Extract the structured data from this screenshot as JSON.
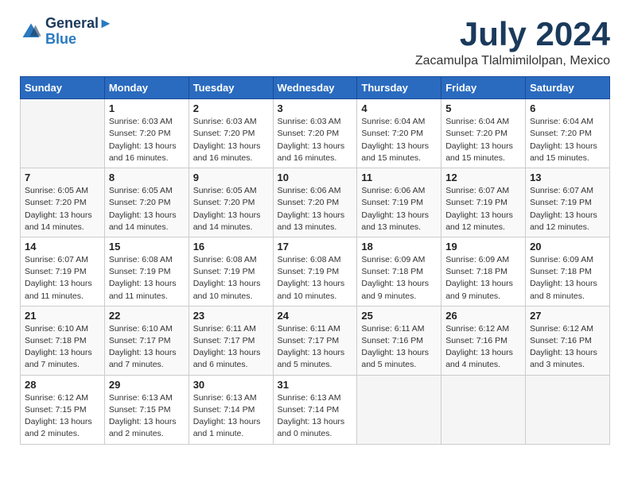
{
  "header": {
    "logo_line1": "General",
    "logo_line2": "Blue",
    "month_title": "July 2024",
    "location": "Zacamulpa Tlalmimilolpan, Mexico"
  },
  "weekdays": [
    "Sunday",
    "Monday",
    "Tuesday",
    "Wednesday",
    "Thursday",
    "Friday",
    "Saturday"
  ],
  "weeks": [
    [
      {
        "day": "",
        "info": ""
      },
      {
        "day": "1",
        "info": "Sunrise: 6:03 AM\nSunset: 7:20 PM\nDaylight: 13 hours\nand 16 minutes."
      },
      {
        "day": "2",
        "info": "Sunrise: 6:03 AM\nSunset: 7:20 PM\nDaylight: 13 hours\nand 16 minutes."
      },
      {
        "day": "3",
        "info": "Sunrise: 6:03 AM\nSunset: 7:20 PM\nDaylight: 13 hours\nand 16 minutes."
      },
      {
        "day": "4",
        "info": "Sunrise: 6:04 AM\nSunset: 7:20 PM\nDaylight: 13 hours\nand 15 minutes."
      },
      {
        "day": "5",
        "info": "Sunrise: 6:04 AM\nSunset: 7:20 PM\nDaylight: 13 hours\nand 15 minutes."
      },
      {
        "day": "6",
        "info": "Sunrise: 6:04 AM\nSunset: 7:20 PM\nDaylight: 13 hours\nand 15 minutes."
      }
    ],
    [
      {
        "day": "7",
        "info": "Sunrise: 6:05 AM\nSunset: 7:20 PM\nDaylight: 13 hours\nand 14 minutes."
      },
      {
        "day": "8",
        "info": "Sunrise: 6:05 AM\nSunset: 7:20 PM\nDaylight: 13 hours\nand 14 minutes."
      },
      {
        "day": "9",
        "info": "Sunrise: 6:05 AM\nSunset: 7:20 PM\nDaylight: 13 hours\nand 14 minutes."
      },
      {
        "day": "10",
        "info": "Sunrise: 6:06 AM\nSunset: 7:20 PM\nDaylight: 13 hours\nand 13 minutes."
      },
      {
        "day": "11",
        "info": "Sunrise: 6:06 AM\nSunset: 7:19 PM\nDaylight: 13 hours\nand 13 minutes."
      },
      {
        "day": "12",
        "info": "Sunrise: 6:07 AM\nSunset: 7:19 PM\nDaylight: 13 hours\nand 12 minutes."
      },
      {
        "day": "13",
        "info": "Sunrise: 6:07 AM\nSunset: 7:19 PM\nDaylight: 13 hours\nand 12 minutes."
      }
    ],
    [
      {
        "day": "14",
        "info": "Sunrise: 6:07 AM\nSunset: 7:19 PM\nDaylight: 13 hours\nand 11 minutes."
      },
      {
        "day": "15",
        "info": "Sunrise: 6:08 AM\nSunset: 7:19 PM\nDaylight: 13 hours\nand 11 minutes."
      },
      {
        "day": "16",
        "info": "Sunrise: 6:08 AM\nSunset: 7:19 PM\nDaylight: 13 hours\nand 10 minutes."
      },
      {
        "day": "17",
        "info": "Sunrise: 6:08 AM\nSunset: 7:19 PM\nDaylight: 13 hours\nand 10 minutes."
      },
      {
        "day": "18",
        "info": "Sunrise: 6:09 AM\nSunset: 7:18 PM\nDaylight: 13 hours\nand 9 minutes."
      },
      {
        "day": "19",
        "info": "Sunrise: 6:09 AM\nSunset: 7:18 PM\nDaylight: 13 hours\nand 9 minutes."
      },
      {
        "day": "20",
        "info": "Sunrise: 6:09 AM\nSunset: 7:18 PM\nDaylight: 13 hours\nand 8 minutes."
      }
    ],
    [
      {
        "day": "21",
        "info": "Sunrise: 6:10 AM\nSunset: 7:18 PM\nDaylight: 13 hours\nand 7 minutes."
      },
      {
        "day": "22",
        "info": "Sunrise: 6:10 AM\nSunset: 7:17 PM\nDaylight: 13 hours\nand 7 minutes."
      },
      {
        "day": "23",
        "info": "Sunrise: 6:11 AM\nSunset: 7:17 PM\nDaylight: 13 hours\nand 6 minutes."
      },
      {
        "day": "24",
        "info": "Sunrise: 6:11 AM\nSunset: 7:17 PM\nDaylight: 13 hours\nand 5 minutes."
      },
      {
        "day": "25",
        "info": "Sunrise: 6:11 AM\nSunset: 7:16 PM\nDaylight: 13 hours\nand 5 minutes."
      },
      {
        "day": "26",
        "info": "Sunrise: 6:12 AM\nSunset: 7:16 PM\nDaylight: 13 hours\nand 4 minutes."
      },
      {
        "day": "27",
        "info": "Sunrise: 6:12 AM\nSunset: 7:16 PM\nDaylight: 13 hours\nand 3 minutes."
      }
    ],
    [
      {
        "day": "28",
        "info": "Sunrise: 6:12 AM\nSunset: 7:15 PM\nDaylight: 13 hours\nand 2 minutes."
      },
      {
        "day": "29",
        "info": "Sunrise: 6:13 AM\nSunset: 7:15 PM\nDaylight: 13 hours\nand 2 minutes."
      },
      {
        "day": "30",
        "info": "Sunrise: 6:13 AM\nSunset: 7:14 PM\nDaylight: 13 hours\nand 1 minute."
      },
      {
        "day": "31",
        "info": "Sunrise: 6:13 AM\nSunset: 7:14 PM\nDaylight: 13 hours\nand 0 minutes."
      },
      {
        "day": "",
        "info": ""
      },
      {
        "day": "",
        "info": ""
      },
      {
        "day": "",
        "info": ""
      }
    ]
  ]
}
